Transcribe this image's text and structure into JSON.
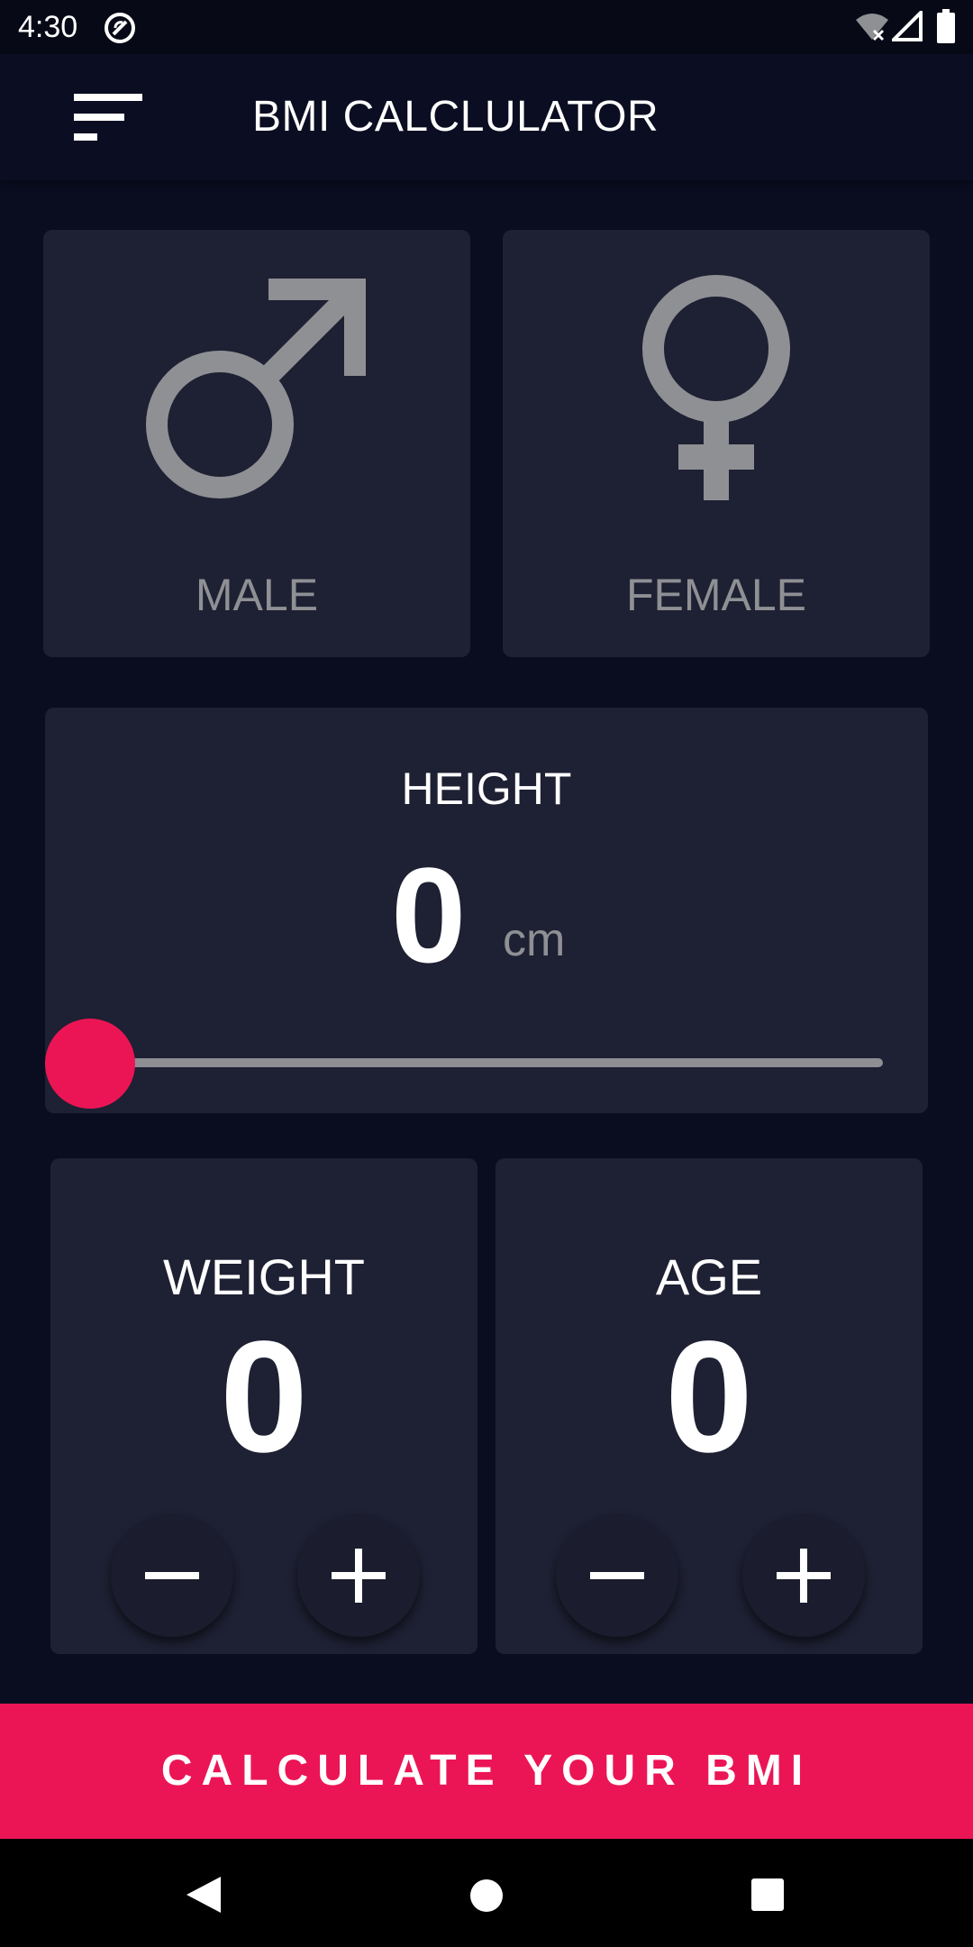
{
  "status_bar": {
    "time": "4:30",
    "icons": [
      "sync-icon",
      "wifi-off-icon",
      "signal-icon",
      "battery-icon"
    ]
  },
  "app_bar": {
    "menu_icon": "menu-icon",
    "title": "BMI CALCLULATOR"
  },
  "gender": {
    "male": {
      "label": "MALE",
      "icon": "male-symbol-icon"
    },
    "female": {
      "label": "FEMALE",
      "icon": "female-symbol-icon"
    }
  },
  "height": {
    "label": "HEIGHT",
    "value": "0",
    "unit": "cm",
    "slider_fraction": 0
  },
  "weight": {
    "label": "WEIGHT",
    "value": "0",
    "minus_icon": "minus-icon",
    "plus_icon": "plus-icon"
  },
  "age": {
    "label": "AGE",
    "value": "0",
    "minus_icon": "minus-icon",
    "plus_icon": "plus-icon"
  },
  "calculate_button": {
    "label": "CALCULATE YOUR BMI"
  },
  "nav_bar": {
    "icons": [
      "back-icon",
      "home-icon",
      "recents-icon"
    ]
  },
  "colors": {
    "background": "#0a0d20",
    "card": "#1e2033",
    "accent": "#eb1555",
    "muted": "#8f9094"
  }
}
